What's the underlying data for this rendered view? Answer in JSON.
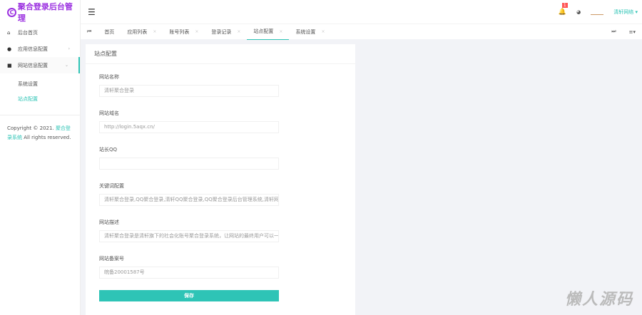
{
  "app": {
    "title": "聚合登录后台管理",
    "logo_glyph": "C"
  },
  "sidebar": {
    "items": [
      {
        "label": "后台首页",
        "icon": "home-icon"
      },
      {
        "label": "应用信息配置",
        "icon": "palette-icon"
      },
      {
        "label": "网站信息配置",
        "icon": "grid-icon"
      }
    ],
    "sub": [
      {
        "label": "系统设置"
      },
      {
        "label": "站点配置"
      }
    ],
    "copyright": "Copyright © 2021.",
    "copyright_link": "聚合登录系统",
    "rights": "All rights reserved."
  },
  "header": {
    "badge": "1",
    "user": "清轩网络"
  },
  "tabs": [
    "首页",
    "应用列表",
    "账号列表",
    "登录记录",
    "站点配置",
    "系统设置"
  ],
  "card": {
    "title": "站点配置",
    "fields": [
      {
        "label": "网站名称",
        "value": "清轩聚合登录"
      },
      {
        "label": "网站域名",
        "value": "http://login.5aqx.cn/"
      },
      {
        "label": "站长QQ",
        "value": ""
      },
      {
        "label": "关键词配置",
        "value": "清轩聚合登录,QQ聚合登录,清轩QQ聚合登录,QQ聚合登录后台管理系统,清轩网络科"
      },
      {
        "label": "网站描述",
        "value": "清轩聚合登录是清轩旗下的社会化账号聚合登录系统，让网站的最终用户可以一站式"
      },
      {
        "label": "网站备案号",
        "value": "皖备20001587号"
      }
    ],
    "save": "保存"
  },
  "watermark": "懒人源码"
}
